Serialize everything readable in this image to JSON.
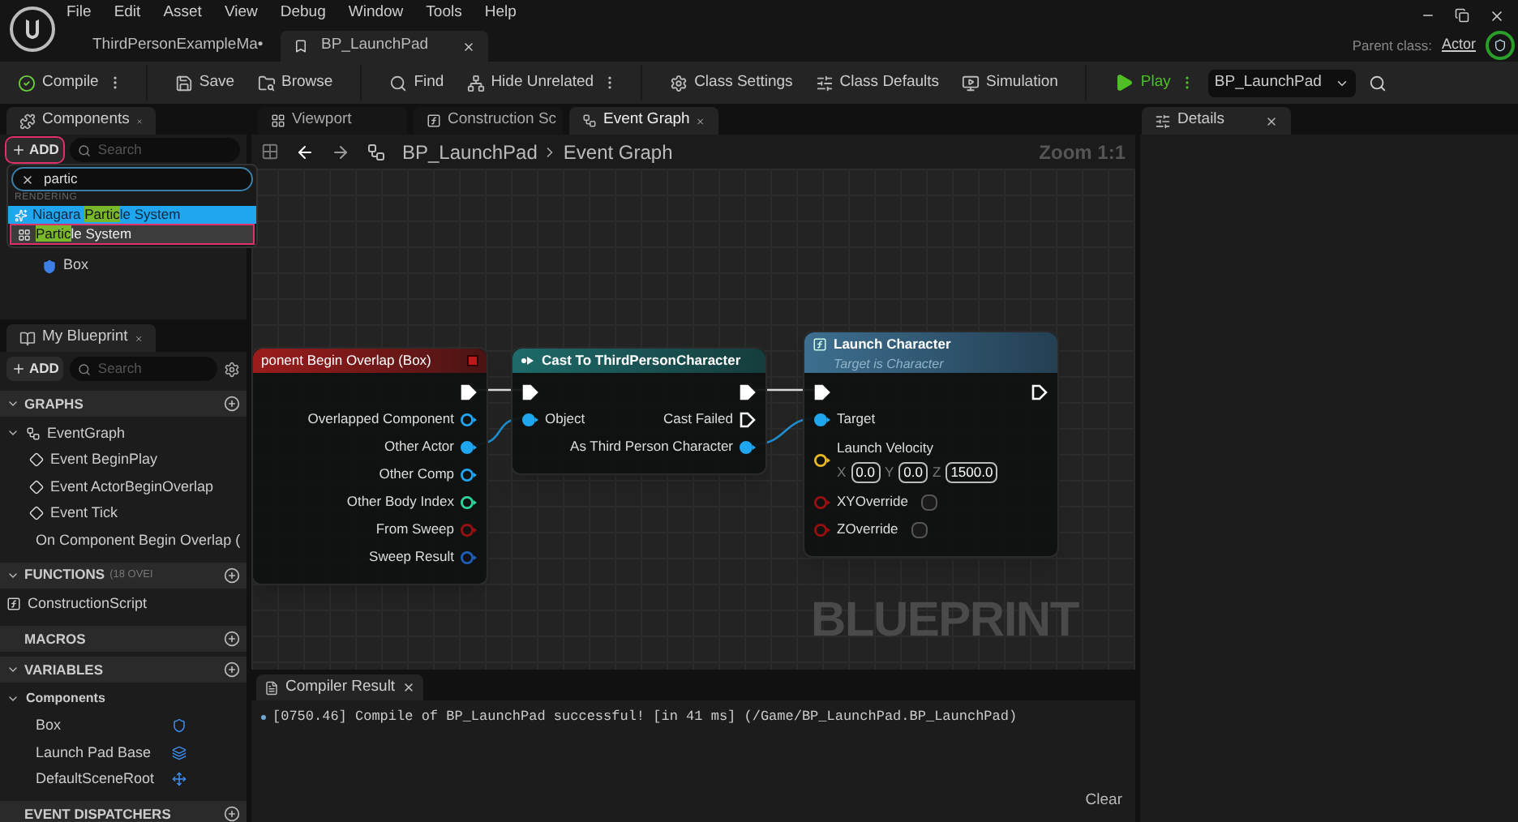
{
  "menu": [
    "File",
    "Edit",
    "Asset",
    "View",
    "Debug",
    "Window",
    "Tools",
    "Help"
  ],
  "document_tabs": [
    {
      "label": "ThirdPersonExampleMa•",
      "selected": false
    },
    {
      "label": "BP_LaunchPad",
      "selected": true
    }
  ],
  "parent_class": {
    "label": "Parent class:",
    "value": "Actor"
  },
  "toolbar": [
    {
      "kind": "compile",
      "label": "Compile",
      "menu": true
    },
    {
      "kind": "save",
      "label": "Save",
      "menu": false
    },
    {
      "kind": "browse",
      "label": "Browse",
      "menu": false
    },
    {
      "kind": "find",
      "label": "Find",
      "menu": false
    },
    {
      "kind": "hide",
      "label": "Hide Unrelated",
      "menu": true
    },
    {
      "kind": "settings",
      "label": "Class Settings",
      "menu": false
    },
    {
      "kind": "defaults",
      "label": "Class Defaults",
      "menu": false
    },
    {
      "kind": "simulation",
      "label": "Simulation",
      "menu": false
    },
    {
      "kind": "play",
      "label": "Play",
      "menu": true
    },
    {
      "kind": "select",
      "label": "BP_LaunchPad"
    }
  ],
  "components_panel": {
    "title": "Components",
    "add_button": {
      "label": "ADD",
      "highlighted": true
    },
    "search": {
      "placeholder": "Search"
    },
    "items": [
      {
        "label": "Box",
        "kind": "box"
      }
    ]
  },
  "add_menu": {
    "query": "partic",
    "category": "RENDERING",
    "items": [
      {
        "before": "Niagara ",
        "match": "Partic",
        "after": "le System",
        "kind": "niagara",
        "selected": true,
        "highlighted": false
      },
      {
        "match": "Partic",
        "after": "le System",
        "kind": "particle",
        "selected": false,
        "highlighted": true
      }
    ]
  },
  "my_blueprint": {
    "title": "My Blueprint",
    "add_button": {
      "label": "ADD"
    },
    "search": {
      "placeholder": "Search"
    },
    "sections": [
      {
        "title": "GRAPHS",
        "expanded": true,
        "items": [
          {
            "label": "EventGraph",
            "kind": "graph",
            "expanded": true,
            "children": [
              {
                "label": "Event BeginPlay",
                "kind": "event"
              },
              {
                "label": "Event ActorBeginOverlap",
                "kind": "event"
              },
              {
                "label": "Event Tick",
                "kind": "event"
              },
              {
                "label": "On Component Begin Overlap (",
                "kind": "event"
              }
            ]
          }
        ]
      },
      {
        "title": "FUNCTIONS",
        "note": "(18 OVEI",
        "expanded": true,
        "items": [
          {
            "label": "ConstructionScript",
            "kind": "function"
          }
        ]
      },
      {
        "title": "MACROS",
        "expanded": false
      },
      {
        "title": "VARIABLES",
        "expanded": true,
        "items": [
          {
            "label": "Components",
            "kind": "category",
            "expanded": true,
            "children": [
              {
                "label": "Box",
                "kind": "box"
              },
              {
                "label": "Launch Pad Base",
                "kind": "mesh"
              },
              {
                "label": "DefaultSceneRoot",
                "kind": "scene"
              }
            ]
          }
        ]
      },
      {
        "title": "EVENT DISPATCHERS",
        "expanded": false
      }
    ]
  },
  "graph_tabs": [
    {
      "label": "Viewport",
      "kind": "viewport",
      "selected": false
    },
    {
      "label": "Construction Sc",
      "kind": "function",
      "selected": false
    },
    {
      "label": "Event Graph",
      "kind": "graph",
      "selected": true
    }
  ],
  "breadcrumb": [
    "BP_LaunchPad",
    "Event Graph"
  ],
  "zoom": "Zoom 1:1",
  "canvas_label": "BLUEPRINT",
  "nodes": [
    {
      "kind": "event",
      "title": "ponent Begin Overlap (Box)",
      "rows": [
        {
          "out": {
            "kind": "exec",
            "connected": true
          }
        },
        {
          "out": {
            "kind": "object",
            "label": "Overlapped Component",
            "connected": false
          }
        },
        {
          "out": {
            "kind": "object",
            "label": "Other Actor",
            "connected": true
          }
        },
        {
          "out": {
            "kind": "object",
            "label": "Other Comp",
            "connected": false
          }
        },
        {
          "out": {
            "kind": "int",
            "label": "Other Body Index",
            "connected": false
          }
        },
        {
          "out": {
            "kind": "bool",
            "label": "From Sweep",
            "connected": false
          }
        },
        {
          "out": {
            "kind": "struct",
            "label": "Sweep Result",
            "connected": false
          }
        }
      ]
    },
    {
      "kind": "cast",
      "title": "Cast To ThirdPersonCharacter",
      "rows": [
        {
          "in": {
            "kind": "exec",
            "connected": true
          },
          "out": {
            "kind": "exec",
            "connected": true
          }
        },
        {
          "in": {
            "kind": "object",
            "label": "Object",
            "connected": true
          },
          "out": {
            "kind": "exec",
            "label": "Cast Failed",
            "connected": false
          }
        },
        {
          "out": {
            "kind": "object",
            "label": "As Third Person Character",
            "connected": true
          }
        }
      ]
    },
    {
      "kind": "function",
      "title": "Launch Character",
      "subtitle": "Target is Character",
      "rows": [
        {
          "in": {
            "kind": "exec",
            "connected": true
          },
          "out": {
            "kind": "exec",
            "connected": false
          }
        },
        {
          "in": {
            "kind": "object",
            "label": "Target",
            "connected": true
          }
        },
        {
          "in": {
            "kind": "vector",
            "label": "Launch Velocity",
            "connected": false,
            "fields": [
              {
                "axis": "X",
                "value": "0.0"
              },
              {
                "axis": "Y",
                "value": "0.0"
              },
              {
                "axis": "Z",
                "value": "1500.0"
              }
            ]
          }
        },
        {
          "in": {
            "kind": "bool",
            "label": "XYOverride",
            "connected": false,
            "checked": false
          }
        },
        {
          "in": {
            "kind": "bool",
            "label": "ZOverride",
            "connected": false,
            "checked": false
          }
        }
      ]
    }
  ],
  "compiler_results": {
    "title": "Compiler Result",
    "messages": [
      "[0750.46] Compile of BP_LaunchPad successful! [in 41 ms] (/Game/BP_LaunchPad.BP_LaunchPad)"
    ],
    "clear": "Clear"
  },
  "details": {
    "title": "Details"
  }
}
